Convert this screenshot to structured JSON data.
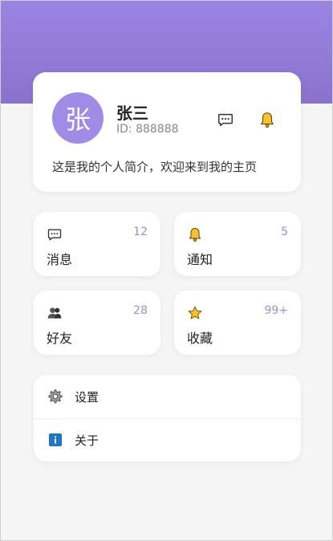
{
  "profile": {
    "avatar_char": "张",
    "name": "张三",
    "id_text": "ID: 888888",
    "bio": "这是我的个人简介，欢迎来到我的主页",
    "actions": [
      {
        "icon": "chat-icon"
      },
      {
        "icon": "bell-icon"
      }
    ]
  },
  "stats": [
    {
      "label": "消息",
      "count": "12",
      "icon": "chat-icon"
    },
    {
      "label": "通知",
      "count": "5",
      "icon": "bell-icon"
    },
    {
      "label": "好友",
      "count": "28",
      "icon": "friends-icon"
    },
    {
      "label": "收藏",
      "count": "99+",
      "icon": "star-icon"
    }
  ],
  "menu": [
    {
      "label": "设置",
      "icon": "gear-icon"
    },
    {
      "label": "关于",
      "icon": "info-icon"
    }
  ],
  "colors": {
    "header_gradient_top": "#9b85e3",
    "header_gradient_bottom": "#8a72cc",
    "avatar_bg": "#a08be6",
    "count_color": "#9b8fd8",
    "background": "#f5f5f5"
  }
}
